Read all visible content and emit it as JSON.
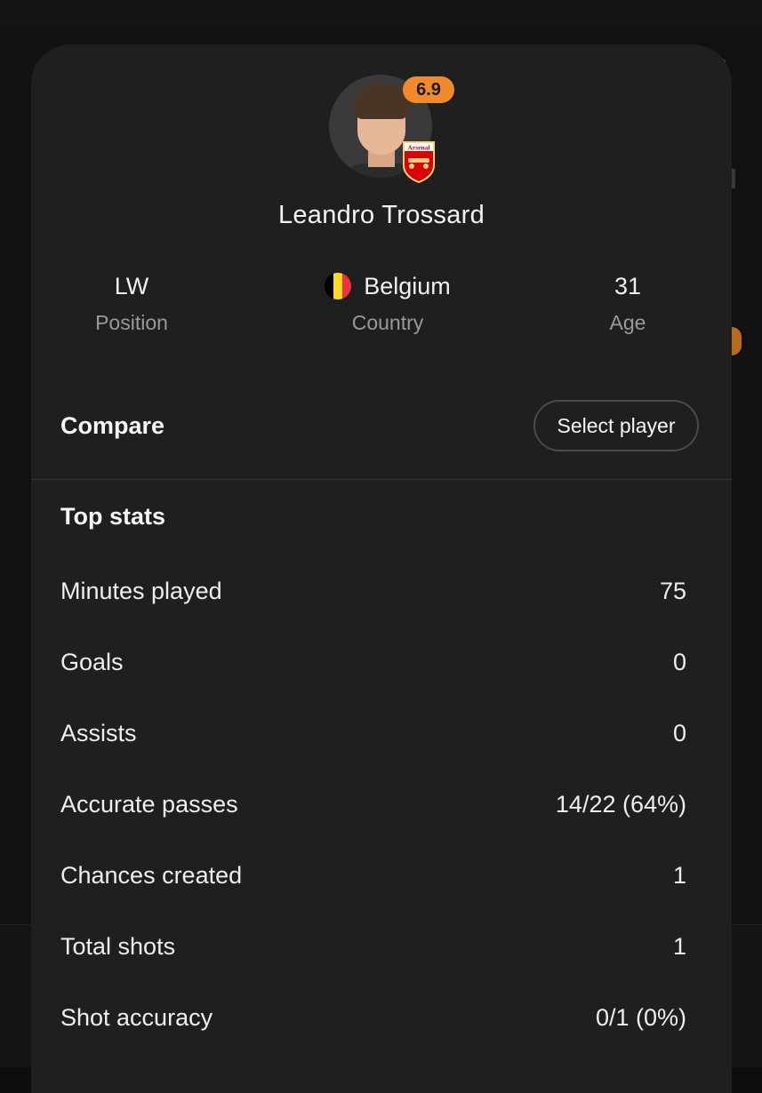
{
  "player": {
    "name": "Leandro Trossard",
    "rating": "6.9",
    "club_crest_text": "Arsenal",
    "rating_color": "#f08a2c"
  },
  "info": [
    {
      "value": "LW",
      "label": "Position"
    },
    {
      "value": "Belgium",
      "label": "Country",
      "flag": [
        "#000000",
        "#fdda24",
        "#ef3340"
      ]
    },
    {
      "value": "31",
      "label": "Age"
    }
  ],
  "compare": {
    "title": "Compare",
    "button_label": "Select player"
  },
  "top_stats": {
    "title": "Top stats",
    "rows": [
      {
        "label": "Minutes played",
        "value": "75"
      },
      {
        "label": "Goals",
        "value": "0"
      },
      {
        "label": "Assists",
        "value": "0"
      },
      {
        "label": "Accurate passes",
        "value": "14/22 (64%)"
      },
      {
        "label": "Chances created",
        "value": "1"
      },
      {
        "label": "Total shots",
        "value": "1"
      },
      {
        "label": "Shot accuracy",
        "value": "0/1 (0%)"
      }
    ]
  },
  "icons": [
    "player-avatar",
    "arsenal-crest-icon",
    "belgium-flag-icon"
  ]
}
